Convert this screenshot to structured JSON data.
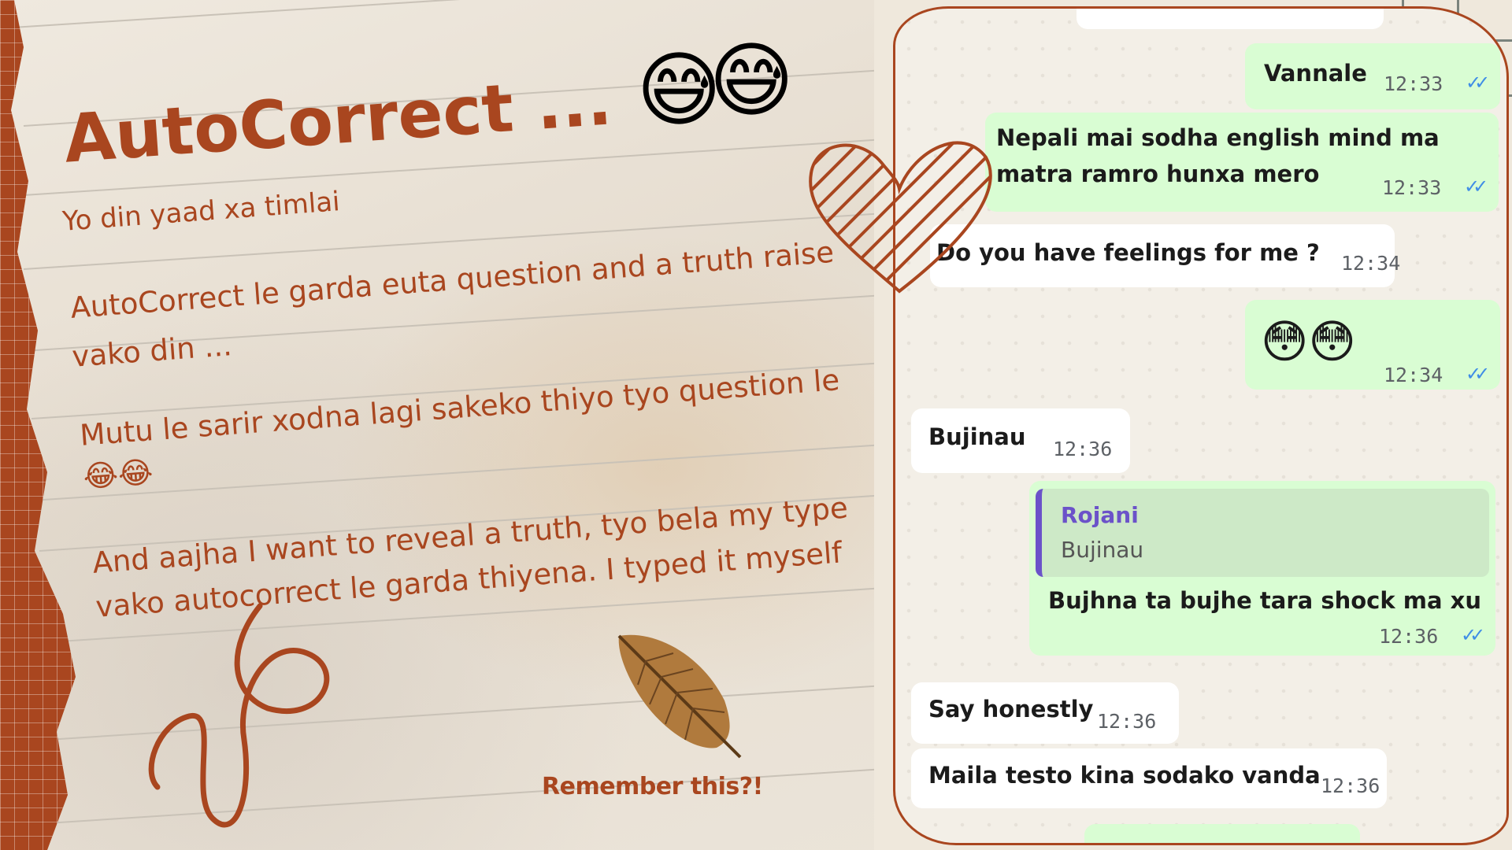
{
  "left_panel": {
    "title": "AutoCorrect ...",
    "title_emojis": [
      "😅",
      "😅"
    ],
    "subtitle": "Yo din yaad xa timlai",
    "paragraph1_line1": "AutoCorrect le garda euta question and a truth raise",
    "paragraph1_line2": "vako din ...",
    "paragraph2_line1": "Mutu le sarir xodna lagi sakeko thiyo tyo question le",
    "paragraph2_emojis": "😂😂",
    "paragraph3_line1": "And aajha I want to reveal a truth, tyo bela my type",
    "paragraph3_line2": "vako autocorrect le garda thiyena. I typed it myself",
    "caption": "Remember this?!"
  },
  "chat": {
    "messages": [
      {
        "direction": "out",
        "text": "Vannale",
        "time": "12:33",
        "read": true
      },
      {
        "direction": "out",
        "text_line1": "Nepali mai sodha english mind ma",
        "text_line2": "matra ramro hunxa mero",
        "time": "12:33",
        "read": true
      },
      {
        "direction": "in",
        "text": "Do you have feelings for me ?",
        "time": "12:34"
      },
      {
        "direction": "out",
        "text": "😳😳",
        "time": "12:34",
        "read": true
      },
      {
        "direction": "in",
        "text": "Bujinau",
        "time": "12:36"
      },
      {
        "direction": "out",
        "reply_to_name": "Rojani",
        "reply_to_text": "Bujinau",
        "text": "Bujhna ta bujhe tara shock ma xu",
        "time": "12:36",
        "read": true
      },
      {
        "direction": "in",
        "text": "Say honestly",
        "time": "12:36"
      },
      {
        "direction": "in",
        "text": "Maila testo kina sodako vanda",
        "time": "12:36"
      }
    ],
    "read_tick_glyph": "✓✓",
    "colors": {
      "outgoing": "#d9fdd3",
      "incoming": "#ffffff",
      "tick": "#3f8de6",
      "reply_bar": "#6b52c9"
    }
  },
  "colors": {
    "accent": "#a9461f",
    "paper": "#ece5da"
  }
}
